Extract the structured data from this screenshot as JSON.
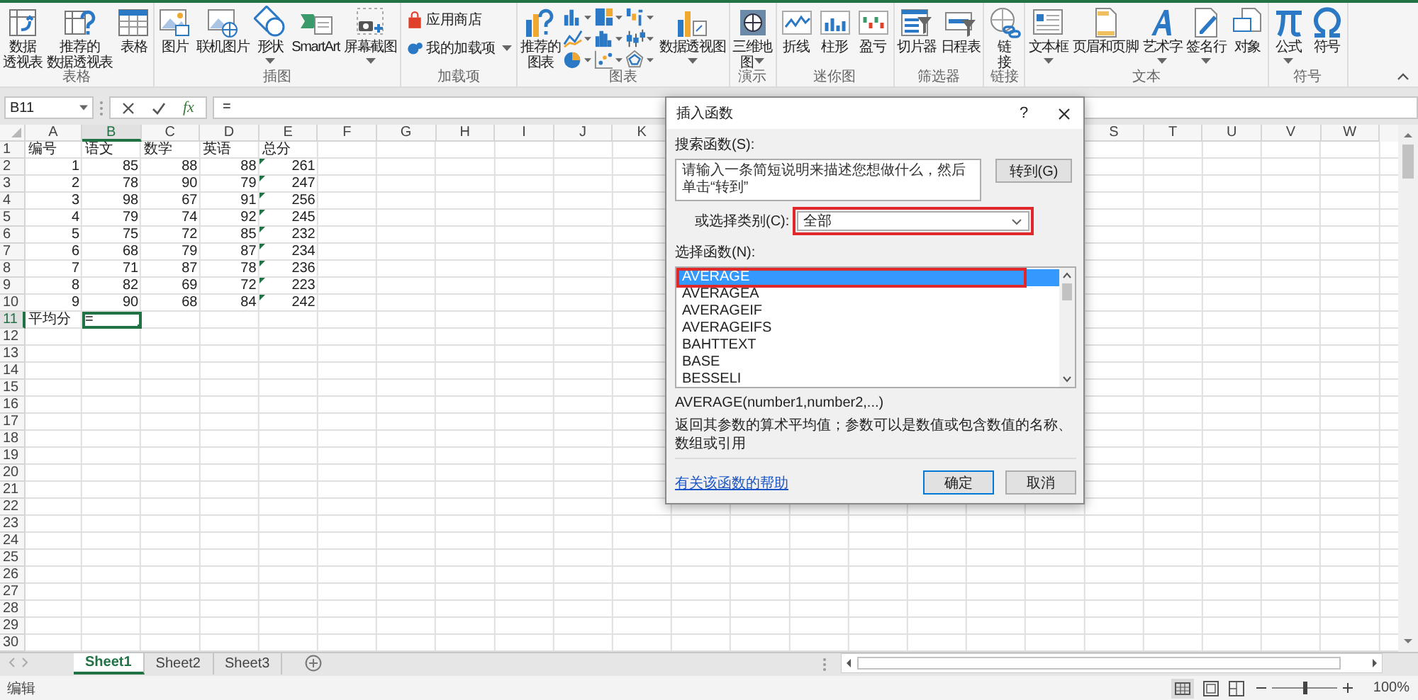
{
  "ribbon": {
    "groups": [
      {
        "label": "表格",
        "items": [
          {
            "kind": "large",
            "lines": [
              "数据",
              "透视表"
            ],
            "dropdown": false
          },
          {
            "kind": "large",
            "lines": [
              "推荐的",
              "数据透视表"
            ],
            "dropdown": false
          },
          {
            "kind": "large",
            "lines": [
              "表格"
            ],
            "dropdown": false
          }
        ]
      },
      {
        "label": "插图",
        "items": [
          {
            "kind": "large",
            "lines": [
              "图片"
            ],
            "dropdown": false
          },
          {
            "kind": "large",
            "lines": [
              "联机图片"
            ],
            "dropdown": false
          },
          {
            "kind": "large",
            "lines": [
              "形状"
            ],
            "dropdown": true
          },
          {
            "kind": "large",
            "lines": [
              "SmartArt"
            ],
            "dropdown": false
          },
          {
            "kind": "large",
            "lines": [
              "屏幕截图"
            ],
            "dropdown": true
          }
        ]
      },
      {
        "label": "加载项",
        "items": [
          {
            "kind": "small",
            "lines": [
              "应用商店"
            ],
            "dropdown": false
          },
          {
            "kind": "small",
            "lines": [
              "我的加载项"
            ],
            "dropdown": true
          }
        ]
      },
      {
        "label": "图表",
        "items": [
          {
            "kind": "large",
            "lines": [
              "推荐的",
              "图表"
            ],
            "dropdown": false
          },
          {
            "kind": "gallery"
          },
          {
            "kind": "large",
            "lines": [
              "数据透视图"
            ],
            "dropdown": true
          }
        ]
      },
      {
        "label": "演示",
        "items": [
          {
            "kind": "large",
            "lines": [
              "三维地",
              "图"
            ],
            "dropdown": true
          }
        ]
      },
      {
        "label": "迷你图",
        "items": [
          {
            "kind": "large",
            "lines": [
              "折线"
            ],
            "dropdown": false
          },
          {
            "kind": "large",
            "lines": [
              "柱形"
            ],
            "dropdown": false
          },
          {
            "kind": "large",
            "lines": [
              "盈亏"
            ],
            "dropdown": false
          }
        ]
      },
      {
        "label": "筛选器",
        "items": [
          {
            "kind": "large",
            "lines": [
              "切片器"
            ],
            "dropdown": false
          },
          {
            "kind": "large",
            "lines": [
              "日程表"
            ],
            "dropdown": false
          }
        ]
      },
      {
        "label": "链接",
        "items": [
          {
            "kind": "large",
            "lines": [
              "链",
              "接"
            ],
            "dropdown": false
          }
        ]
      },
      {
        "label": "文本",
        "items": [
          {
            "kind": "large",
            "lines": [
              "文本框"
            ],
            "dropdown": true
          },
          {
            "kind": "large",
            "lines": [
              "页眉和页脚"
            ],
            "dropdown": false
          },
          {
            "kind": "large",
            "lines": [
              "艺术字"
            ],
            "dropdown": true
          },
          {
            "kind": "large",
            "lines": [
              "签名行"
            ],
            "dropdown": true
          },
          {
            "kind": "large",
            "lines": [
              "对象"
            ],
            "dropdown": false
          }
        ]
      },
      {
        "label": "符号",
        "items": [
          {
            "kind": "large",
            "lines": [
              "公式"
            ],
            "dropdown": true
          },
          {
            "kind": "large",
            "lines": [
              "符号"
            ],
            "dropdown": false
          }
        ]
      }
    ]
  },
  "formula_bar": {
    "name_box": "B11",
    "function_button": "fx",
    "value": "="
  },
  "sheet": {
    "columns_left": [
      {
        "label": "A",
        "selected": false
      },
      {
        "label": "B",
        "selected": true
      },
      {
        "label": "C",
        "selected": false
      },
      {
        "label": "D",
        "selected": false
      },
      {
        "label": "E",
        "selected": false
      },
      {
        "label": "F",
        "selected": false
      },
      {
        "label": "G",
        "selected": false
      },
      {
        "label": "H",
        "selected": false
      },
      {
        "label": "I",
        "selected": false
      },
      {
        "label": "J",
        "selected": false
      },
      {
        "label": "K",
        "selected": false
      }
    ],
    "columns_right": [
      {
        "label": "S",
        "selected": false
      },
      {
        "label": "T",
        "selected": false
      },
      {
        "label": "U",
        "selected": false
      },
      {
        "label": "V",
        "selected": false
      },
      {
        "label": "W",
        "selected": false
      }
    ],
    "rows": [
      {
        "label": "1",
        "selected": false,
        "kind": "text",
        "flagged": false,
        "cells": [
          {
            "text": "编号",
            "selected": false
          },
          {
            "text": "语文",
            "selected": false
          },
          {
            "text": "数学",
            "selected": false
          },
          {
            "text": "英语",
            "selected": false
          },
          {
            "text": "总分",
            "selected": false
          }
        ]
      },
      {
        "label": "2",
        "selected": false,
        "kind": "number",
        "flagged": true,
        "cells": [
          {
            "text": "1",
            "selected": false
          },
          {
            "text": "85",
            "selected": false
          },
          {
            "text": "88",
            "selected": false
          },
          {
            "text": "88",
            "selected": false
          },
          {
            "text": "261",
            "selected": false
          }
        ]
      },
      {
        "label": "3",
        "selected": false,
        "kind": "number",
        "flagged": true,
        "cells": [
          {
            "text": "2",
            "selected": false
          },
          {
            "text": "78",
            "selected": false
          },
          {
            "text": "90",
            "selected": false
          },
          {
            "text": "79",
            "selected": false
          },
          {
            "text": "247",
            "selected": false
          }
        ]
      },
      {
        "label": "4",
        "selected": false,
        "kind": "number",
        "flagged": true,
        "cells": [
          {
            "text": "3",
            "selected": false
          },
          {
            "text": "98",
            "selected": false
          },
          {
            "text": "67",
            "selected": false
          },
          {
            "text": "91",
            "selected": false
          },
          {
            "text": "256",
            "selected": false
          }
        ]
      },
      {
        "label": "5",
        "selected": false,
        "kind": "number",
        "flagged": true,
        "cells": [
          {
            "text": "4",
            "selected": false
          },
          {
            "text": "79",
            "selected": false
          },
          {
            "text": "74",
            "selected": false
          },
          {
            "text": "92",
            "selected": false
          },
          {
            "text": "245",
            "selected": false
          }
        ]
      },
      {
        "label": "6",
        "selected": false,
        "kind": "number",
        "flagged": true,
        "cells": [
          {
            "text": "5",
            "selected": false
          },
          {
            "text": "75",
            "selected": false
          },
          {
            "text": "72",
            "selected": false
          },
          {
            "text": "85",
            "selected": false
          },
          {
            "text": "232",
            "selected": false
          }
        ]
      },
      {
        "label": "7",
        "selected": false,
        "kind": "number",
        "flagged": true,
        "cells": [
          {
            "text": "6",
            "selected": false
          },
          {
            "text": "68",
            "selected": false
          },
          {
            "text": "79",
            "selected": false
          },
          {
            "text": "87",
            "selected": false
          },
          {
            "text": "234",
            "selected": false
          }
        ]
      },
      {
        "label": "8",
        "selected": false,
        "kind": "number",
        "flagged": true,
        "cells": [
          {
            "text": "7",
            "selected": false
          },
          {
            "text": "71",
            "selected": false
          },
          {
            "text": "87",
            "selected": false
          },
          {
            "text": "78",
            "selected": false
          },
          {
            "text": "236",
            "selected": false
          }
        ]
      },
      {
        "label": "9",
        "selected": false,
        "kind": "number",
        "flagged": true,
        "cells": [
          {
            "text": "8",
            "selected": false
          },
          {
            "text": "82",
            "selected": false
          },
          {
            "text": "69",
            "selected": false
          },
          {
            "text": "72",
            "selected": false
          },
          {
            "text": "223",
            "selected": false
          }
        ]
      },
      {
        "label": "10",
        "selected": false,
        "kind": "number",
        "flagged": true,
        "cells": [
          {
            "text": "9",
            "selected": false
          },
          {
            "text": "90",
            "selected": false
          },
          {
            "text": "68",
            "selected": false
          },
          {
            "text": "84",
            "selected": false
          },
          {
            "text": "242",
            "selected": false
          }
        ]
      },
      {
        "label": "11",
        "selected": true,
        "kind": "text",
        "flagged": false,
        "cells": [
          {
            "text": "平均分",
            "selected": false
          },
          {
            "text": "=",
            "selected": true
          }
        ]
      },
      {
        "label": "12",
        "selected": false,
        "flagged": false
      },
      {
        "label": "13",
        "selected": false,
        "flagged": false
      },
      {
        "label": "14",
        "selected": false,
        "flagged": false
      },
      {
        "label": "15",
        "selected": false,
        "flagged": false
      },
      {
        "label": "16",
        "selected": false,
        "flagged": false
      },
      {
        "label": "17",
        "selected": false,
        "flagged": false
      },
      {
        "label": "18",
        "selected": false,
        "flagged": false
      },
      {
        "label": "19",
        "selected": false,
        "flagged": false
      },
      {
        "label": "20",
        "selected": false,
        "flagged": false
      },
      {
        "label": "21",
        "selected": false,
        "flagged": false
      },
      {
        "label": "22",
        "selected": false,
        "flagged": false
      },
      {
        "label": "23",
        "selected": false,
        "flagged": false
      },
      {
        "label": "24",
        "selected": false,
        "flagged": false
      },
      {
        "label": "25",
        "selected": false,
        "flagged": false
      },
      {
        "label": "26",
        "selected": false,
        "flagged": false
      },
      {
        "label": "27",
        "selected": false,
        "flagged": false
      },
      {
        "label": "28",
        "selected": false,
        "flagged": false
      },
      {
        "label": "29",
        "selected": false,
        "flagged": false
      },
      {
        "label": "30",
        "selected": false,
        "flagged": false
      }
    ]
  },
  "dialog": {
    "title": "插入函数",
    "help_button": "?",
    "search_label": "搜索函数(S):",
    "search_value": "请输入一条简短说明来描述您想做什么，然后单击“转到”",
    "go_button": "转到(G)",
    "category_label": "或选择类别(C):",
    "category_value": "全部",
    "function_label": "选择函数(N):",
    "functions": [
      {
        "name": "AVERAGE",
        "selected": true
      },
      {
        "name": "AVERAGEA",
        "selected": false
      },
      {
        "name": "AVERAGEIF",
        "selected": false
      },
      {
        "name": "AVERAGEIFS",
        "selected": false
      },
      {
        "name": "BAHTTEXT",
        "selected": false
      },
      {
        "name": "BASE",
        "selected": false
      },
      {
        "name": "BESSELI",
        "selected": false
      }
    ],
    "signature": "AVERAGE(number1,number2,...)",
    "description": "返回其参数的算术平均值；参数可以是数值或包含数值的名称、数组或引用",
    "help_link": "有关该函数的帮助",
    "ok_button": "确定",
    "cancel_button": "取消"
  },
  "sheet_tabs": [
    {
      "label": "Sheet1",
      "selected": true
    },
    {
      "label": "Sheet2",
      "selected": false
    },
    {
      "label": "Sheet3",
      "selected": false
    }
  ],
  "status_bar": {
    "mode": "编辑",
    "zoom": {
      "level": 0.5,
      "reading": "100%"
    }
  }
}
